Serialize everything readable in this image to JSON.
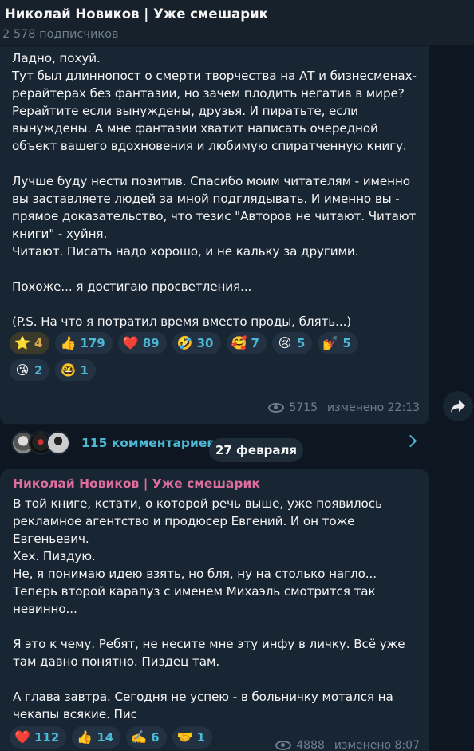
{
  "header": {
    "title": "Николай Новиков | Уже смешарик",
    "subscribers": "2 578 подписчиков"
  },
  "post1": {
    "text": "Ладно, похуй.\nТут был длиннопост о смерти творчества на АТ и бизнесменах-рерайтерах без фантазии, но зачем плодить негатив в мире? Рерайтите если вынуждены, друзья. И пиратьте, если вынуждены. А мне фантазии хватит написать очередной объект вашего вдохновения и любимую спиратченную книгу.\n\nЛучше буду нести позитив. Спасибо моим читателям - именно вы заставляете людей за мной подглядывать. И именно вы - прямое доказательство, что тезис \"Авторов не читают. Читают книги\" - хуйня.\nЧитают. Писать надо хорошо, и не кальку за другими.\n\nПохоже... я достигаю просветления...\n\n(P.S. На что я потратил время вместо проды, блять...)",
    "reactions": [
      {
        "emoji": "⭐",
        "count": "4",
        "mine": true
      },
      {
        "emoji": "👍",
        "count": "179"
      },
      {
        "emoji": "❤️",
        "count": "89"
      },
      {
        "emoji": "🤣",
        "count": "30"
      },
      {
        "emoji": "🥰",
        "count": "7"
      },
      {
        "emoji": "😢",
        "count": "5"
      },
      {
        "emoji": "💅",
        "count": "5"
      },
      {
        "emoji": "😘",
        "count": "2"
      },
      {
        "emoji": "🤓",
        "count": "1"
      }
    ],
    "views": "5715",
    "edited": "изменено 22:13",
    "comments_label": "115 комментариев"
  },
  "date_separator": "27 февраля",
  "post2": {
    "author": "Николай Новиков | Уже смешарик",
    "text": "В той книге, кстати, о которой речь выше, уже появилось рекламное агентство и продюсер Евгений. И он тоже Евгеньевич.\nХех. Пиздую.\nНе, я понимаю идею взять, но бля, ну на столько нагло...\nТеперь второй карапуз с именем Михаэль смотрится так невинно...\n\nЯ это к чему. Ребят, не несите мне эту инфу в личку. Всё уже там давно понятно. Пиздец там.\n\nА глава завтра. Сегодня не успею - в больничку мотался на чекапы всякие. Пис",
    "reactions": [
      {
        "emoji": "❤️",
        "count": "112"
      },
      {
        "emoji": "👍",
        "count": "14"
      },
      {
        "emoji": "✍️",
        "count": "6"
      },
      {
        "emoji": "🤝",
        "count": "1"
      }
    ],
    "views": "4888",
    "edited": "изменено 8:07"
  },
  "colors": {
    "background": "#0e1621",
    "bubble": "#182533",
    "accent": "#4db8d4",
    "author": "#dd6e9d"
  },
  "icons": {
    "views": "eye-icon",
    "share": "share-arrow-icon",
    "chevron": "chevron-right-icon"
  }
}
